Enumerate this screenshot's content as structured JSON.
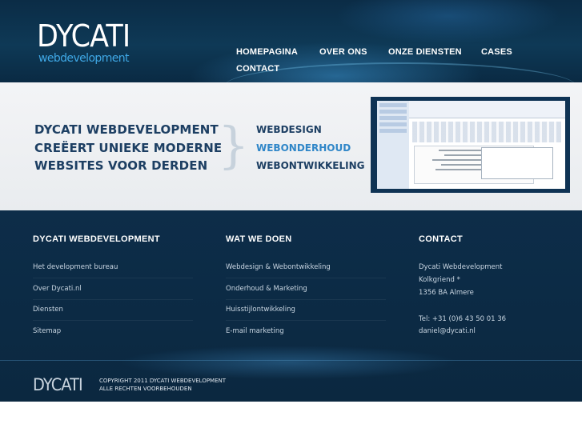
{
  "header": {
    "logo_main": "DYCATI",
    "logo_sub": "webdevelopment",
    "nav": [
      {
        "label": "HOMEPAGINA"
      },
      {
        "label": "OVER ONS"
      },
      {
        "label": "ONZE DIENSTEN"
      },
      {
        "label": "CASES"
      },
      {
        "label": "CONTACT"
      }
    ]
  },
  "banner": {
    "tagline": [
      "DYCATI WEBDEVELOPMENT",
      "CREËERT UNIEKE MODERNE",
      "WEBSITES VOOR DERDEN"
    ],
    "brace": "}",
    "services": [
      {
        "label": "WEBDESIGN",
        "active": false
      },
      {
        "label": "WEBONDERHOUD",
        "active": true
      },
      {
        "label": "WEBONTWIKKELING",
        "active": false
      }
    ],
    "accent_color": "#2f86c8",
    "text_color": "#1d3f63"
  },
  "footer": {
    "columns": [
      {
        "title": "DYCATI WEBDEVELOPMENT",
        "links": [
          "Het development bureau",
          "Over Dycati.nl",
          "Diensten",
          "Sitemap"
        ]
      },
      {
        "title": "WAT WE DOEN",
        "links": [
          "Webdesign & Webontwikkeling",
          "Onderhoud & Marketing",
          "Huisstijlontwikkeling",
          "E-mail marketing"
        ]
      },
      {
        "title": "CONTACT",
        "lines": [
          "Dycati Webdevelopment",
          "Kolkgriend *",
          "1356 BA Almere",
          "Tel: +31 (0)6 43 50 01 36",
          "daniel@dycati.nl"
        ]
      }
    ],
    "logo": "DYCATI",
    "copyright": [
      "COPYRIGHT 2011 DYCATI WEBDEVELOPMENT",
      "ALLE RECHTEN VOORBEHOUDEN"
    ]
  }
}
